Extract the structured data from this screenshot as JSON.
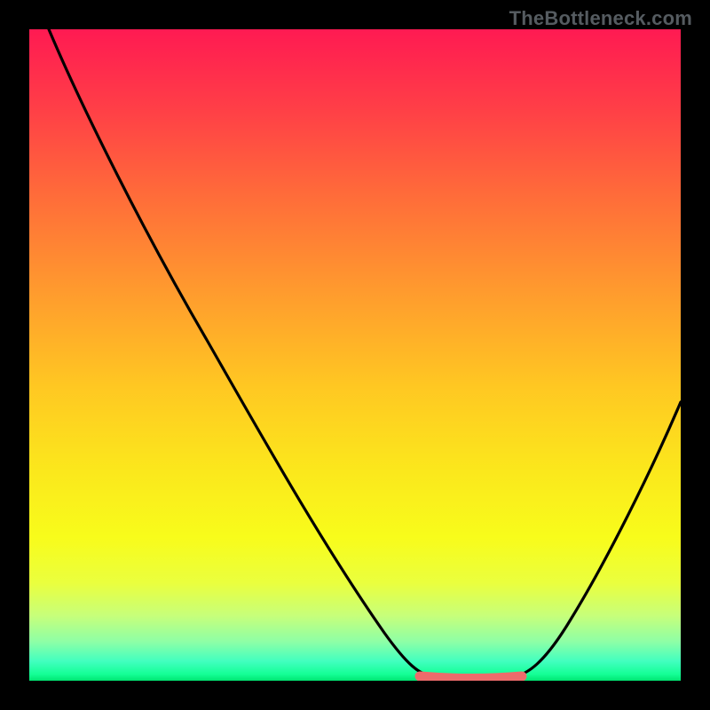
{
  "watermark": "TheBottleneck.com",
  "chart_data": {
    "type": "line",
    "title": "",
    "xlabel": "",
    "ylabel": "",
    "x_range": [
      0,
      100
    ],
    "y_range": [
      0,
      100
    ],
    "series": [
      {
        "name": "curve",
        "color": "#000000",
        "points": [
          {
            "x": 3,
            "y": 100
          },
          {
            "x": 10,
            "y": 85
          },
          {
            "x": 20,
            "y": 67
          },
          {
            "x": 30,
            "y": 50
          },
          {
            "x": 40,
            "y": 33
          },
          {
            "x": 50,
            "y": 15
          },
          {
            "x": 57,
            "y": 3
          },
          {
            "x": 60,
            "y": 0.5
          },
          {
            "x": 68,
            "y": 0.5
          },
          {
            "x": 75,
            "y": 0.5
          },
          {
            "x": 80,
            "y": 6
          },
          {
            "x": 88,
            "y": 22
          },
          {
            "x": 95,
            "y": 40
          },
          {
            "x": 100,
            "y": 52
          }
        ]
      },
      {
        "name": "flat-segment",
        "color": "#ed6b6b",
        "thick": true,
        "points": [
          {
            "x": 60,
            "y": 0.5
          },
          {
            "x": 75,
            "y": 0.5
          }
        ]
      }
    ]
  }
}
